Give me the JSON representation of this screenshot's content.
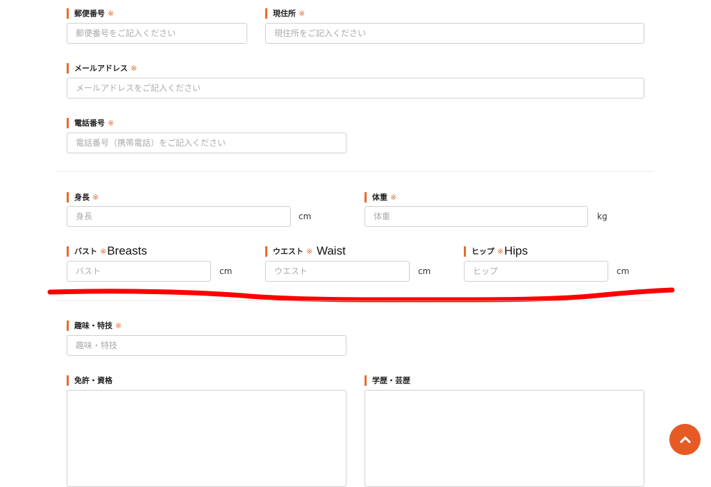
{
  "fields": {
    "postal": {
      "label": "郵便番号",
      "required_mark": "※",
      "placeholder": "郵便番号をご記入ください"
    },
    "address": {
      "label": "現住所",
      "required_mark": "※",
      "placeholder": "現住所をご記入ください"
    },
    "email": {
      "label": "メールアドレス",
      "required_mark": "※",
      "placeholder": "メールアドレスをご記入ください"
    },
    "phone": {
      "label": "電話番号",
      "required_mark": "※",
      "placeholder": "電話番号（携帯電話）をご記入ください"
    },
    "height": {
      "label": "身長",
      "required_mark": "※",
      "placeholder": "身長",
      "unit": "cm"
    },
    "weight": {
      "label": "体重",
      "required_mark": "※",
      "placeholder": "体重",
      "unit": "kg"
    },
    "bust": {
      "label": "バスト",
      "required_mark": "※",
      "annotation": "Breasts",
      "placeholder": "バスト",
      "unit": "cm"
    },
    "waist": {
      "label": "ウエスト",
      "required_mark": "※",
      "annotation": " Waist",
      "placeholder": "ウエスト",
      "unit": "cm"
    },
    "hip": {
      "label": "ヒップ",
      "required_mark": "※",
      "annotation": "Hips",
      "placeholder": "ヒップ",
      "unit": "cm"
    },
    "hobby": {
      "label": "趣味・特技",
      "required_mark": "※",
      "placeholder": "趣味・特技"
    },
    "license": {
      "label": "免許・資格"
    },
    "education": {
      "label": "学歴・芸歴"
    }
  },
  "colors": {
    "accent": "#e8692b",
    "scroll_button": "#e65a25",
    "annotation_stroke": "#ff0000"
  },
  "icons": {
    "scroll_top": "chevron-up-icon"
  }
}
